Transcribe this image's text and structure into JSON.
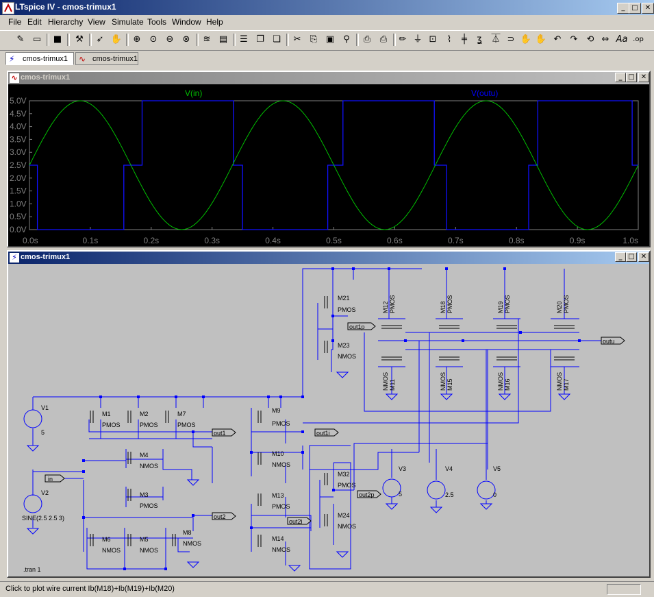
{
  "window": {
    "title": "LTspice IV - cmos-trimux1"
  },
  "menu": [
    "File",
    "Edit",
    "Hierarchy",
    "View",
    "Simulate",
    "Tools",
    "Window",
    "Help"
  ],
  "tabs": [
    {
      "label": "cmos-trimux1",
      "icon": "schematic-icon"
    },
    {
      "label": "cmos-trimux1",
      "icon": "waveform-icon"
    }
  ],
  "plot_window": {
    "title": "cmos-trimux1"
  },
  "schematic_window": {
    "title": "cmos-trimux1"
  },
  "status": {
    "text": "Click to plot wire current Ib(M18)+Ib(M19)+Ib(M20)"
  },
  "colors": {
    "plot_bg": "#000000",
    "grid": "#808080",
    "vin": "#00c000",
    "voutu": "#0000ff",
    "axis_text": "#808080",
    "wire": "#0000ff",
    "schematic_bg": "#c0c0c0"
  },
  "chart_data": {
    "type": "line",
    "title": "",
    "xlabel": "",
    "ylabel": "",
    "xlim": [
      0,
      1.0
    ],
    "ylim": [
      0,
      5.0
    ],
    "x_ticks": [
      "0.0s",
      "0.1s",
      "0.2s",
      "0.3s",
      "0.4s",
      "0.5s",
      "0.6s",
      "0.7s",
      "0.8s",
      "0.9s",
      "1.0s"
    ],
    "y_ticks": [
      "0.0V",
      "0.5V",
      "1.0V",
      "1.5V",
      "2.0V",
      "2.5V",
      "3.0V",
      "3.5V",
      "4.0V",
      "4.5V",
      "5.0V"
    ],
    "grid": false,
    "series": [
      {
        "name": "V(in)",
        "color": "#00c000",
        "x": [
          0.0,
          0.0417,
          0.0833,
          0.125,
          0.1667,
          0.2083,
          0.25,
          0.2917,
          0.3333,
          0.375,
          0.4167,
          0.4583,
          0.5,
          0.5417,
          0.5833,
          0.625,
          0.6667,
          0.7083,
          0.75,
          0.7917,
          0.8333,
          0.875,
          0.9167,
          0.9583,
          1.0
        ],
        "y": [
          2.5,
          4.27,
          5.0,
          4.27,
          2.5,
          0.73,
          0.0,
          0.73,
          2.5,
          4.27,
          5.0,
          4.27,
          2.5,
          0.73,
          0.0,
          0.73,
          2.5,
          4.27,
          5.0,
          4.27,
          2.5,
          0.73,
          0.0,
          0.73,
          2.5
        ]
      },
      {
        "name": "V(outu)",
        "color": "#0000ff",
        "x": [
          0.0,
          0.013,
          0.013,
          0.018,
          0.018,
          0.155,
          0.155,
          0.18,
          0.18,
          0.185,
          0.185,
          0.32,
          0.32,
          0.335,
          0.335,
          0.35,
          0.35,
          0.49,
          0.49,
          0.5,
          0.5,
          0.515,
          0.515,
          0.665,
          0.665,
          0.675,
          0.675,
          0.685,
          0.685,
          0.82,
          0.82,
          0.835,
          0.835,
          0.85,
          0.85,
          0.99,
          0.99,
          1.0
        ],
        "y": [
          2.5,
          2.5,
          0.0,
          0.0,
          0.0,
          0.0,
          2.5,
          2.5,
          2.5,
          2.5,
          5.0,
          5.0,
          5.0,
          5.0,
          2.5,
          2.5,
          0.0,
          0.0,
          2.5,
          2.5,
          2.5,
          2.5,
          5.0,
          5.0,
          2.5,
          2.5,
          2.5,
          2.5,
          0.0,
          0.0,
          2.5,
          2.5,
          5.0,
          5.0,
          5.0,
          5.0,
          2.5,
          2.5
        ]
      }
    ]
  },
  "schematic": {
    "labels": [
      "M1",
      "M2",
      "M7",
      "M4",
      "M3",
      "M6",
      "M5",
      "M8",
      "M9",
      "M10",
      "M13",
      "M14",
      "M21",
      "M23",
      "M32",
      "M24",
      "M12",
      "M18",
      "M19",
      "M20",
      "M11",
      "M15",
      "M16",
      "M17",
      "V1",
      "V2",
      "V3",
      "V4",
      "V5"
    ],
    "type_labels": {
      "pmos": "PMOS",
      "nmos": "NMOS"
    },
    "nets": [
      "in",
      "out1",
      "out1i",
      "out2",
      "out2i",
      "out1p",
      "out2p",
      "outu"
    ],
    "values": {
      "v1": "5",
      "v2": "SINE(2.5 2.5 3)",
      "v3": "5",
      "v4": "2.5",
      "v5": "0"
    },
    "directive": ".tran 1"
  }
}
